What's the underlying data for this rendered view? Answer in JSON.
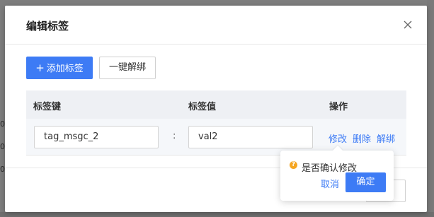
{
  "background": {
    "row_markers": [
      "0",
      "0",
      "0"
    ]
  },
  "dialog": {
    "title": "编辑标签",
    "close_icon": "close-icon"
  },
  "toolbar": {
    "add_label": "添加标签",
    "add_icon": "plus-icon",
    "unbind_all_label": "一键解绑"
  },
  "table": {
    "columns": [
      "标签键",
      "标签值",
      "操作"
    ],
    "rows": [
      {
        "key": "tag_msgc_2",
        "separator": ":",
        "value": "val2",
        "actions": [
          "修改",
          "删除",
          "解绑"
        ]
      }
    ]
  },
  "popconfirm": {
    "icon": "warning-icon",
    "message": "是否确认修改",
    "cancel_label": "取消",
    "ok_label": "确定"
  },
  "colors": {
    "primary": "#3d7bf5",
    "warning": "#f5a623",
    "overlay": "#7d7d7d",
    "header_bg": "#eef0f4"
  }
}
